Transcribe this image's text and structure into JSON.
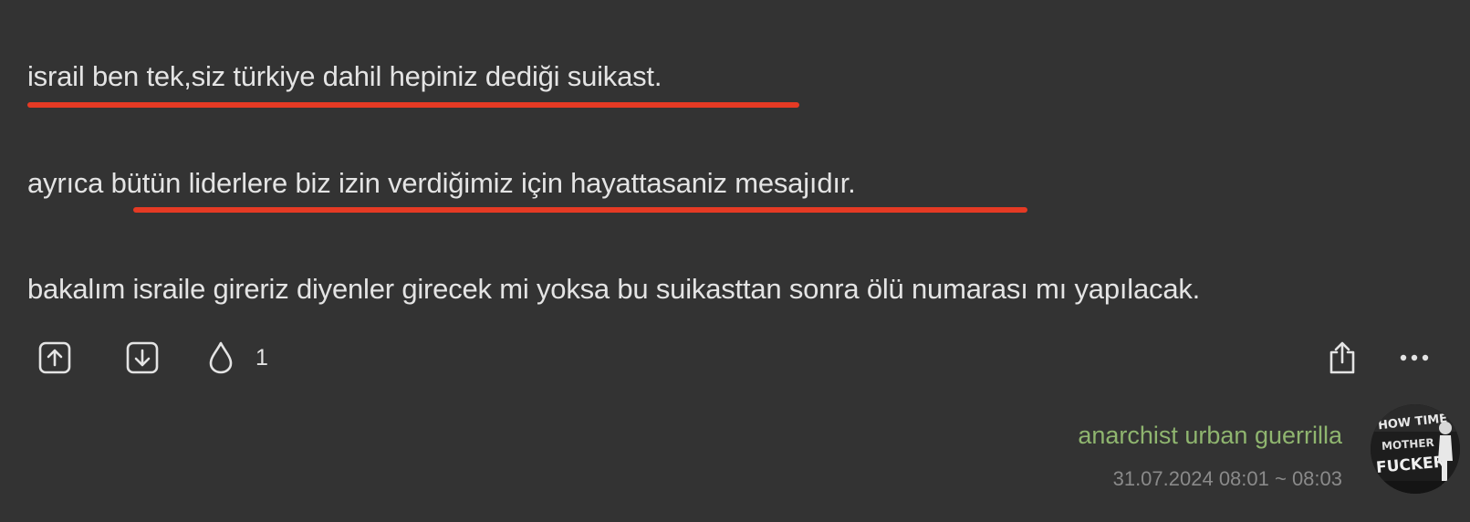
{
  "entry": {
    "paragraphs": [
      "israil ben tek,siz türkiye dahil hepiniz dediği suikast.",
      "ayrıca bütün liderlere biz izin verdiğimiz için hayattasaniz mesajıdır.",
      "bakalım israile gireriz diyenler girecek mi yoksa bu suikasttan sonra ölü numarası mı yapılacak."
    ],
    "highlight_color": "#e53a24"
  },
  "actions": {
    "upvote_icon": "upvote-icon",
    "downvote_icon": "downvote-icon",
    "favorite_icon": "drop-icon",
    "favorite_count": "1",
    "share_icon": "share-icon",
    "more_icon": "more-icon"
  },
  "author": {
    "name": "anarchist urban guerrilla",
    "timestamp": "31.07.2024 08:01 ~ 08:03",
    "name_color": "#8fb56f",
    "avatar_text": "HOW TIME MOTHER FUCKER"
  }
}
